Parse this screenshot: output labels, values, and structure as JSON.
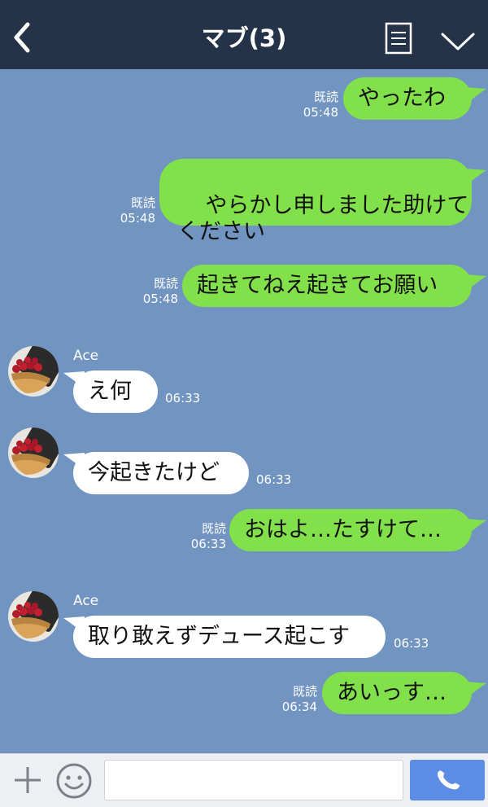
{
  "header": {
    "title": "マブ(3)"
  },
  "messages": [
    {
      "side": "out",
      "text": "やったわ",
      "read": "既読",
      "time": "05:48"
    },
    {
      "side": "out",
      "text": "やらかし申しました助けて\nください",
      "read": "既読",
      "time": "05:48"
    },
    {
      "side": "out",
      "text": "起きてねえ起きてお願い",
      "read": "既読",
      "time": "05:48"
    },
    {
      "side": "in",
      "sender": "Ace",
      "text": "え何",
      "time": "06:33"
    },
    {
      "side": "in",
      "text": "今起きたけど",
      "time": "06:33"
    },
    {
      "side": "out",
      "text": "おはよ…たすけて…",
      "read": "既読",
      "time": "06:33"
    },
    {
      "side": "in",
      "sender": "Ace",
      "text": "取り敢えずデュース起こす",
      "time": "06:33"
    },
    {
      "side": "out",
      "text": "あいっす…",
      "read": "既読",
      "time": "06:34"
    }
  ],
  "input": {
    "value": ""
  },
  "colors": {
    "header_bg": "#253349",
    "chat_bg": "#7194c1",
    "outgoing_bubble": "#82e04b",
    "incoming_bubble": "#ffffff",
    "call_button": "#5a8de3"
  },
  "icons": {
    "back": "chevron-left-icon",
    "notes": "notes-icon",
    "menu": "chevron-down-icon",
    "add": "plus-icon",
    "emoji": "smiley-icon",
    "call": "phone-icon"
  }
}
